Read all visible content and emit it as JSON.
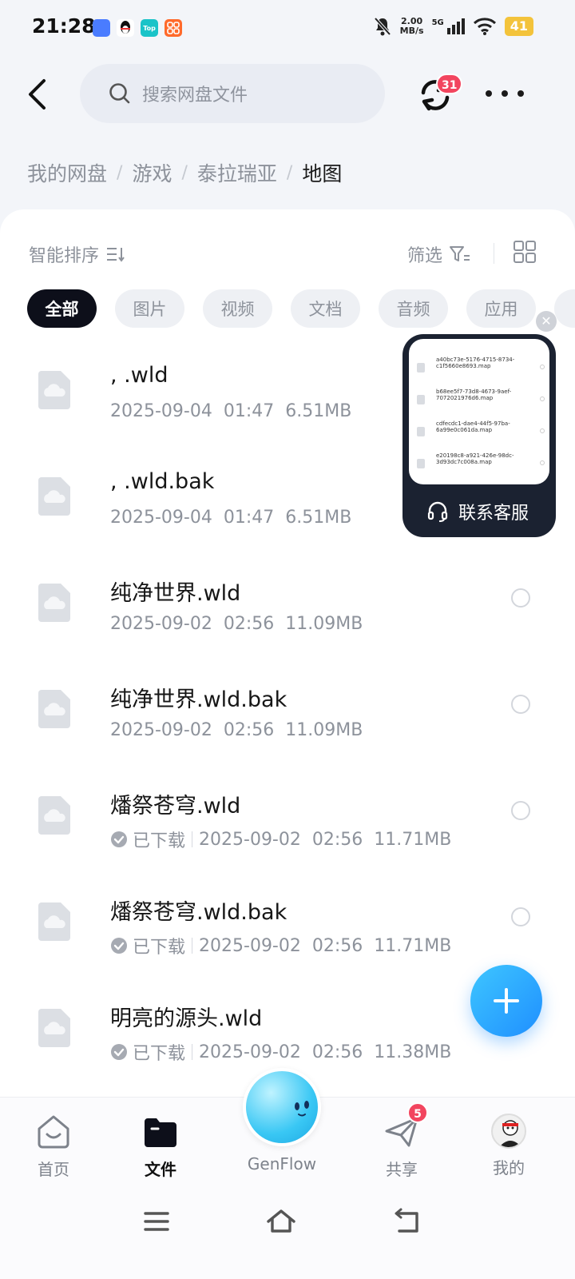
{
  "status_bar": {
    "time": "21:28",
    "apps": [
      {
        "name": "GenFlow",
        "icon": "genflow-app-icon",
        "color": "#4a7cff"
      },
      {
        "name": "QQ",
        "icon": "qq-app-icon",
        "color": "#111111"
      },
      {
        "name": "Top",
        "icon": "top-app-icon",
        "color": "#19c3c8"
      },
      {
        "name": "Grid",
        "icon": "orange-app-icon",
        "color": "#ff6a2b"
      }
    ],
    "speed_value": "2.00",
    "speed_unit": "MB/s",
    "network": "5G",
    "battery": "41"
  },
  "header": {
    "search_placeholder": "搜索网盘文件",
    "sync_badge": "31"
  },
  "breadcrumb": [
    "我的网盘",
    "游戏",
    "泰拉瑞亚",
    "地图"
  ],
  "toolbar": {
    "sort_label": "智能排序",
    "filter_label": "筛选"
  },
  "chips": [
    "全部",
    "图片",
    "视频",
    "文档",
    "音频",
    "应用"
  ],
  "files": [
    {
      "name": ", .wld",
      "downloaded": false,
      "date": "2025-09-04",
      "time": "01:47",
      "size": "6.51MB"
    },
    {
      "name": ", .wld.bak",
      "downloaded": false,
      "date": "2025-09-04",
      "time": "01:47",
      "size": "6.51MB"
    },
    {
      "name": "纯净世界.wld",
      "downloaded": false,
      "date": "2025-09-02",
      "time": "02:56",
      "size": "11.09MB"
    },
    {
      "name": "纯净世界.wld.bak",
      "downloaded": false,
      "date": "2025-09-02",
      "time": "02:56",
      "size": "11.09MB"
    },
    {
      "name": "燔祭苍穹.wld",
      "downloaded": true,
      "date": "2025-09-02",
      "time": "02:56",
      "size": "11.71MB"
    },
    {
      "name": "燔祭苍穹.wld.bak",
      "downloaded": true,
      "date": "2025-09-02",
      "time": "02:56",
      "size": "11.71MB"
    },
    {
      "name": "明亮的源头.wld",
      "downloaded": true,
      "date": "2025-09-02",
      "time": "02:56",
      "size": "11.38MB"
    }
  ],
  "downloaded_label": "已下载",
  "support": {
    "label": "联系客服",
    "preview_rows": [
      "a40bc73e-5176-4715-8734-c1f5660e8693.map",
      "b68ee5f7-73d8-4673-9aef-7072021976d6.map",
      "cdfecdc1-dae4-44f5-97ba-6a99e0c061da.map",
      "e20198c8-a921-426e-98dc-3d93dc7c008a.map"
    ]
  },
  "bottom_nav": {
    "items": [
      "首页",
      "文件",
      "GenFlow",
      "共享",
      "我的"
    ],
    "share_badge": "5"
  }
}
